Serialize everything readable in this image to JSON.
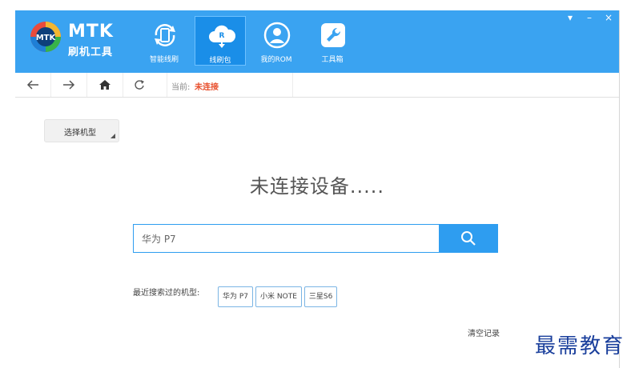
{
  "app": {
    "brand_title": "MTK",
    "brand_subtitle": "刷机工具",
    "header_color": "#3aa3f1"
  },
  "nav": {
    "items": [
      {
        "label": "智能线刷",
        "icon": "phone-refresh-icon"
      },
      {
        "label": "线刷包",
        "icon": "cloud-download-icon",
        "badge": "R",
        "active": true
      },
      {
        "label": "我的ROM",
        "icon": "user-icon"
      },
      {
        "label": "工具箱",
        "icon": "wrench-icon"
      }
    ]
  },
  "window_controls": {
    "menu": "▾",
    "minimize": "–",
    "close": "×"
  },
  "toolbar": {
    "status_prefix": "当前:",
    "status_value": "未连接",
    "status_color": "#e8502e"
  },
  "model_select": {
    "label": "选择机型"
  },
  "main": {
    "status_message": "未连接设备....."
  },
  "search": {
    "value": "华为 P7"
  },
  "recent": {
    "label": "最近搜索过的机型:",
    "items": [
      "华为 P7",
      "小米 NOTE",
      "三星S6"
    ]
  },
  "clear_label": "清空记录",
  "watermark": "最需教育"
}
